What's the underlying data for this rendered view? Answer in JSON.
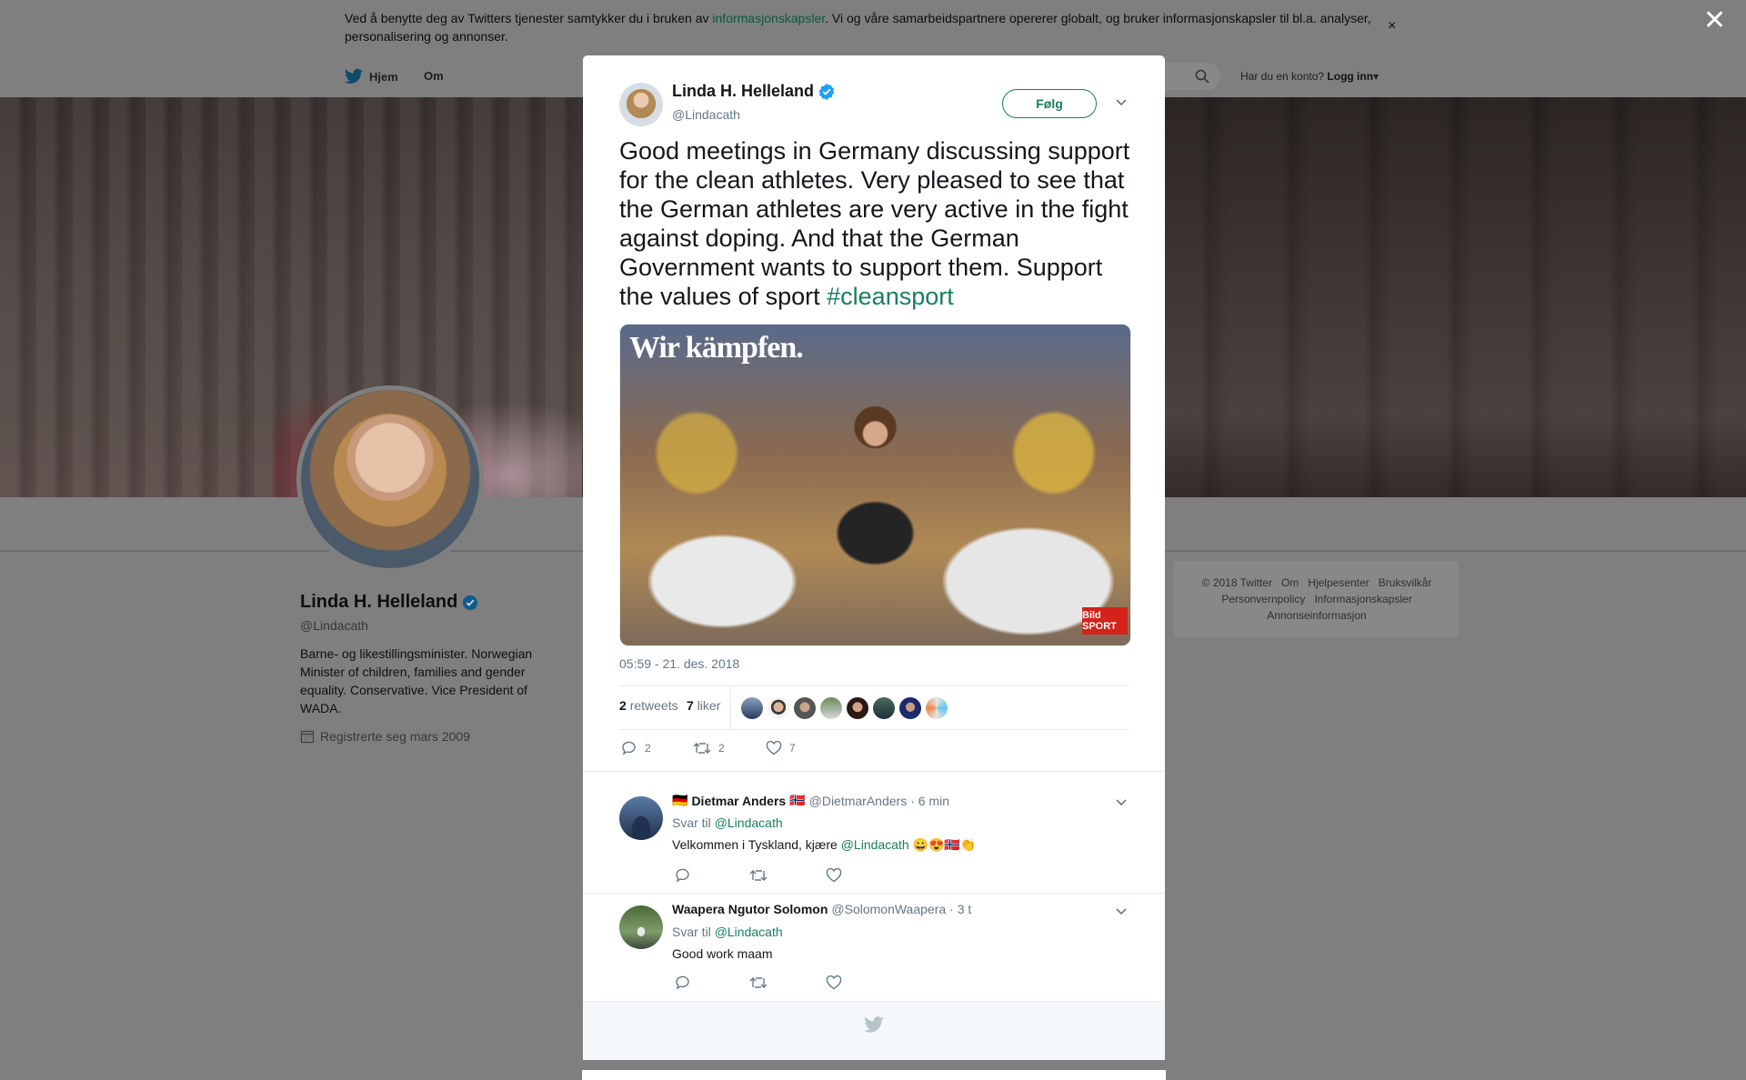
{
  "cookie": {
    "text_before": "Ved å benytte deg av Twitters tjenester samtykker du i bruken av ",
    "link": "informasjonskapsler",
    "text_after": ". Vi og våre samarbeidspartnere opererer globalt, og bruker informasjonskapsler til bl.a. analyser, personalisering og annonser.",
    "close": "×"
  },
  "overlay_close": "✕",
  "nav": {
    "home": "Hjem",
    "about": "Om",
    "login_question": "Har du en konto?",
    "login": "Logg inn"
  },
  "profile": {
    "name": "Linda H. Helleland",
    "handle": "@Lindacath",
    "bio": "Barne- og likestillingsminister. Norwegian Minister of children, families and gender equality. Conservative. Vice President of WADA.",
    "joined": "Registrerte seg mars 2009"
  },
  "footer": {
    "copyright": "© 2018 Twitter",
    "links": [
      "Om",
      "Hjelpesenter",
      "Bruksvilkår",
      "Personvernpolicy",
      "Informasjonskapsler",
      "Annonseinformasjon"
    ]
  },
  "tweet": {
    "author_name": "Linda H. Helleland",
    "author_handle": "@Lindacath",
    "follow_label": "Følg",
    "text": "Good meetings in Germany discussing support for the clean athletes. Very pleased to see that the German athletes are very active in the fight against doping. And that the German Government wants to support them. Support the values of sport ",
    "hashtag": "#cleansport",
    "media_caption": "Wir kämpfen.",
    "media_logo": "Bild SPORT",
    "timestamp": "05:59 - 21. des. 2018",
    "retweets_count": "2",
    "retweets_label": "retweets",
    "likes_count": "7",
    "likes_label": "liker",
    "reply_count": "2",
    "retweet_count": "2",
    "like_count": "7"
  },
  "replies": [
    {
      "flag_before": "🇩🇪",
      "name": "Dietmar Anders",
      "flag_after": "🇳🇴",
      "handle": "@DietmarAnders",
      "time": "· 6 min",
      "reply_to_label": "Svar til",
      "reply_to": "@Lindacath",
      "body_before": "Velkommen i Tyskland, kjære ",
      "body_mention": "@Lindacath",
      "body_after": " 😀😍🇳🇴👏"
    },
    {
      "name": "Waapera Ngutor Solomon",
      "handle": "@SolomonWaapera",
      "time": "· 3 t",
      "reply_to_label": "Svar til",
      "reply_to": "@Lindacath",
      "body": "Good work maam"
    }
  ],
  "colors": {
    "accent": "#17805a",
    "verified": "#1da1f2",
    "muted": "#657786"
  }
}
